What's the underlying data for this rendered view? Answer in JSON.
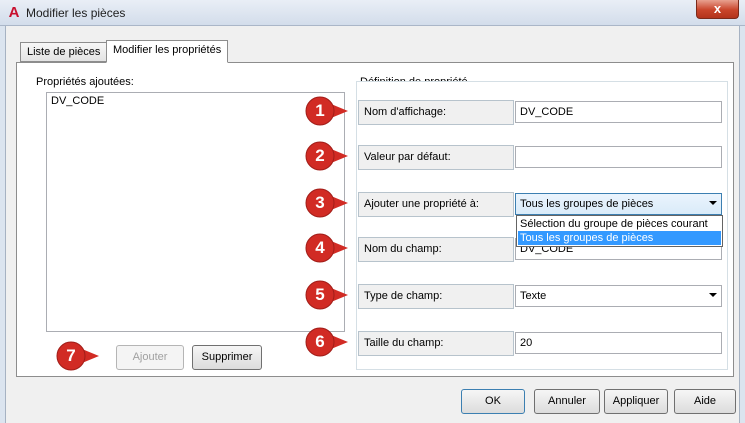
{
  "window": {
    "title": "Modifier les pièces",
    "close_glyph": "x"
  },
  "tabs": [
    {
      "label": "Liste de pièces"
    },
    {
      "label": "Modifier les propriétés"
    }
  ],
  "added_properties": {
    "label": "Propriétés ajoutées:",
    "items": [
      "DV_CODE"
    ],
    "add_button": "Ajouter",
    "delete_button": "Supprimer"
  },
  "definition": {
    "group_label": "Définition de propriété",
    "display_name": {
      "label": "Nom d'affichage:",
      "value": "DV_CODE"
    },
    "default_value": {
      "label": "Valeur par défaut:",
      "value": ""
    },
    "add_property_to": {
      "label": "Ajouter une propriété à:",
      "value": "Tous les groupes de pièces",
      "options": [
        "Sélection du groupe de pièces courant",
        "Tous les groupes de pièces"
      ]
    },
    "field_name": {
      "label": "Nom du champ:",
      "value": "DV_CODE"
    },
    "field_type": {
      "label": "Type de champ:",
      "value": "Texte"
    },
    "field_size": {
      "label": "Taille du champ:",
      "value": "20"
    }
  },
  "callouts": [
    "1",
    "2",
    "3",
    "4",
    "5",
    "6",
    "7"
  ],
  "footer": {
    "ok": "OK",
    "cancel": "Annuler",
    "apply": "Appliquer",
    "help": "Aide"
  },
  "colors": {
    "callout_red": "#d12b24",
    "selection_blue": "#3399ff",
    "app_icon_red": "#c8102e"
  }
}
